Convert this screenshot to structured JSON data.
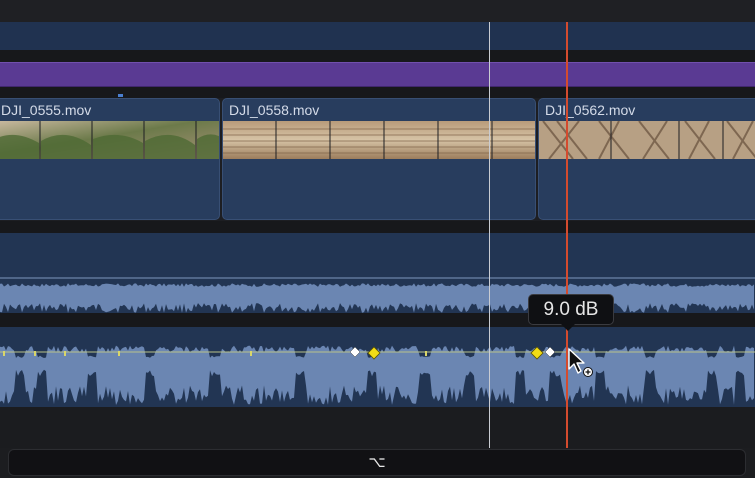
{
  "timeline": {
    "clips": [
      {
        "name": "DJI_0555.mov"
      },
      {
        "name": "DJI_0558.mov"
      },
      {
        "name": "DJI_0562.mov"
      }
    ],
    "volume_tooltip": "9.0 dB",
    "modifier_key": "⌥"
  },
  "colors": {
    "background": "#1d1e22",
    "purple_title_lane": "#5a3a93",
    "clip_fill": "#283d5e",
    "audio_waveform": "#6b86b2",
    "playhead": "#d44b2e",
    "skimmer": "#c9ccd2",
    "keyframe_active": "#f2dc16",
    "keyframe": "#ffffff"
  },
  "icons": [
    "pointer-with-add-keyframe-icon",
    "keyframe-diamond-icon"
  ]
}
